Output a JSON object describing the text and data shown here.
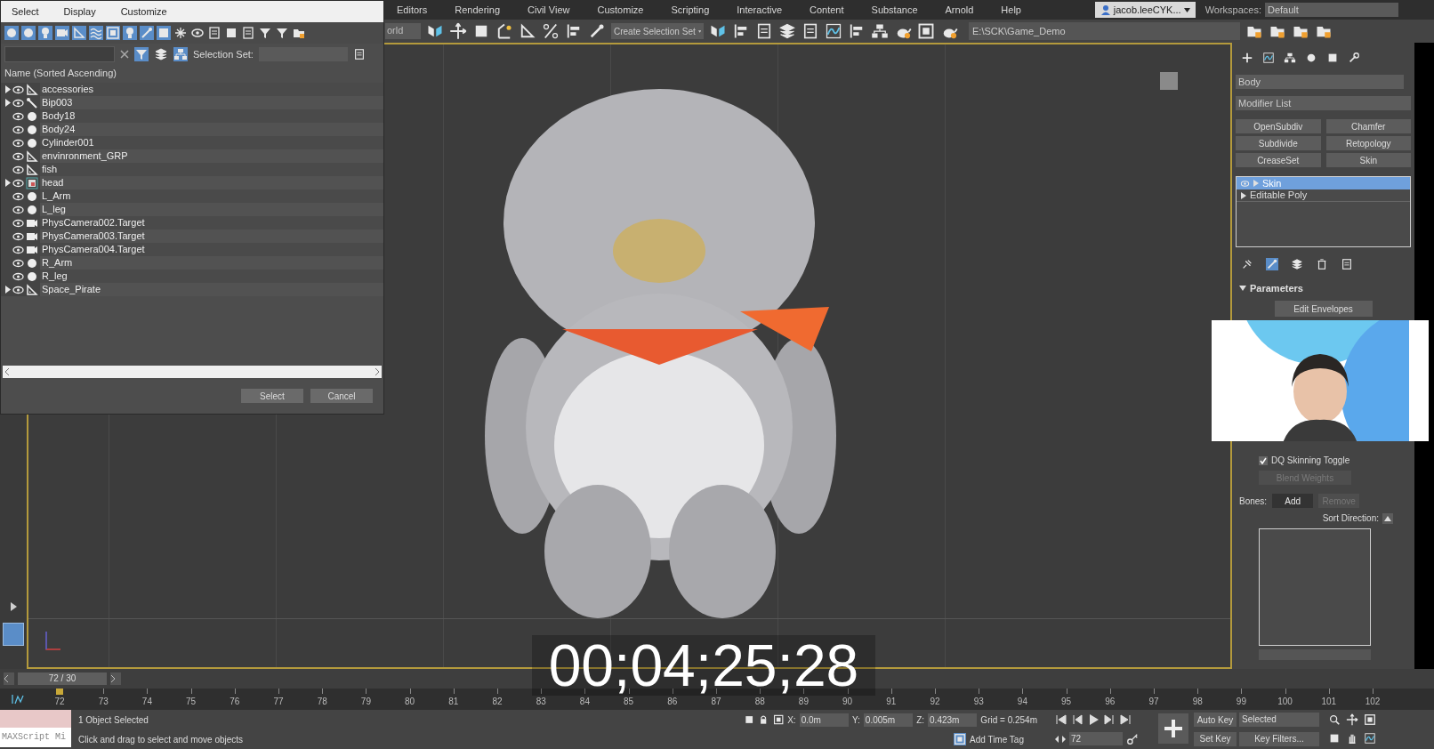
{
  "menu_bar": {
    "items": [
      "Editors",
      "Rendering",
      "Civil View",
      "Customize",
      "Scripting",
      "Interactive",
      "Content",
      "Substance",
      "Arnold",
      "Help"
    ],
    "user": "jacob.leeCYK...",
    "workspaces_label": "Workspaces:",
    "workspace": "Default"
  },
  "main_toolbar": {
    "reference_coord": "orld",
    "selection_set": "Create Selection Set",
    "project_path": "E:\\SCK\\Game_Demo"
  },
  "scene_explorer": {
    "menu": [
      "Select",
      "Display",
      "Customize"
    ],
    "selection_set_label": "Selection Set:",
    "column_header": "Name (Sorted Ascending)",
    "items": [
      {
        "name": "accessories",
        "kind": "helper",
        "expandable": true
      },
      {
        "name": "Bip003",
        "kind": "bone",
        "expandable": true
      },
      {
        "name": "Body18",
        "kind": "geometry",
        "expandable": false
      },
      {
        "name": "Body24",
        "kind": "geometry",
        "expandable": false
      },
      {
        "name": "Cylinder001",
        "kind": "geometry",
        "expandable": false
      },
      {
        "name": "envinronment_GRP",
        "kind": "helper",
        "expandable": false
      },
      {
        "name": "fish",
        "kind": "helper",
        "expandable": false
      },
      {
        "name": "head",
        "kind": "group",
        "expandable": true
      },
      {
        "name": "L_Arm",
        "kind": "geometry",
        "expandable": false
      },
      {
        "name": "L_leg",
        "kind": "geometry",
        "expandable": false
      },
      {
        "name": "PhysCamera002.Target",
        "kind": "camera",
        "expandable": false
      },
      {
        "name": "PhysCamera003.Target",
        "kind": "camera",
        "expandable": false
      },
      {
        "name": "PhysCamera004.Target",
        "kind": "camera",
        "expandable": false
      },
      {
        "name": "R_Arm",
        "kind": "geometry",
        "expandable": false
      },
      {
        "name": "R_leg",
        "kind": "geometry",
        "expandable": false
      },
      {
        "name": "Space_Pirate",
        "kind": "helper",
        "expandable": true
      }
    ],
    "buttons": [
      "Select",
      "Cancel"
    ]
  },
  "command_panel": {
    "object_name": "Body",
    "modifier_list": "Modifier List",
    "modifier_buttons": [
      "OpenSubdiv",
      "Chamfer",
      "Subdivide",
      "Retopology",
      "CreaseSet",
      "Skin"
    ],
    "stack": [
      {
        "name": "Skin",
        "selected": true,
        "visible_toggle": true
      },
      {
        "name": "Editable Poly",
        "selected": false,
        "visible_toggle": false
      }
    ],
    "rollout": "Parameters",
    "edit_envelopes": "Edit Envelopes",
    "dq_toggle": {
      "label": "DQ Skinning Toggle",
      "checked": true
    },
    "blend_weights": {
      "label": "Blend Weights",
      "disabled": true
    },
    "bones_label": "Bones:",
    "bones_buttons": [
      {
        "label": "Add",
        "disabled": false
      },
      {
        "label": "Remove",
        "disabled": true
      }
    ],
    "sort_direction_label": "Sort Direction:"
  },
  "viewport": {
    "timecode": "00;04;25;28"
  },
  "time_slider": {
    "frame": "72 / 30"
  },
  "ruler": {
    "ticks": [
      "72",
      "73",
      "74",
      "75",
      "76",
      "77",
      "78",
      "79",
      "80",
      "81",
      "82",
      "83",
      "84",
      "85",
      "86",
      "87",
      "88",
      "89",
      "90",
      "91",
      "92",
      "93",
      "94",
      "95",
      "96",
      "97",
      "98",
      "99",
      "100",
      "101",
      "102"
    ]
  },
  "status": {
    "maxscript": "MAXScript Mi",
    "selection": "1 Object Selected",
    "prompt": "Click and drag to select and move objects",
    "coords": [
      {
        "label": "X:",
        "value": "0.0m"
      },
      {
        "label": "Y:",
        "value": "0.005m"
      },
      {
        "label": "Z:",
        "value": "0.423m"
      }
    ],
    "grid": "Grid = 0.254m",
    "time_tag": "Add Time Tag",
    "current_frame": "72",
    "auto_key": "Auto Key",
    "key_mode": "Selected",
    "set_key": "Set Key",
    "key_filters": "Key Filters..."
  }
}
